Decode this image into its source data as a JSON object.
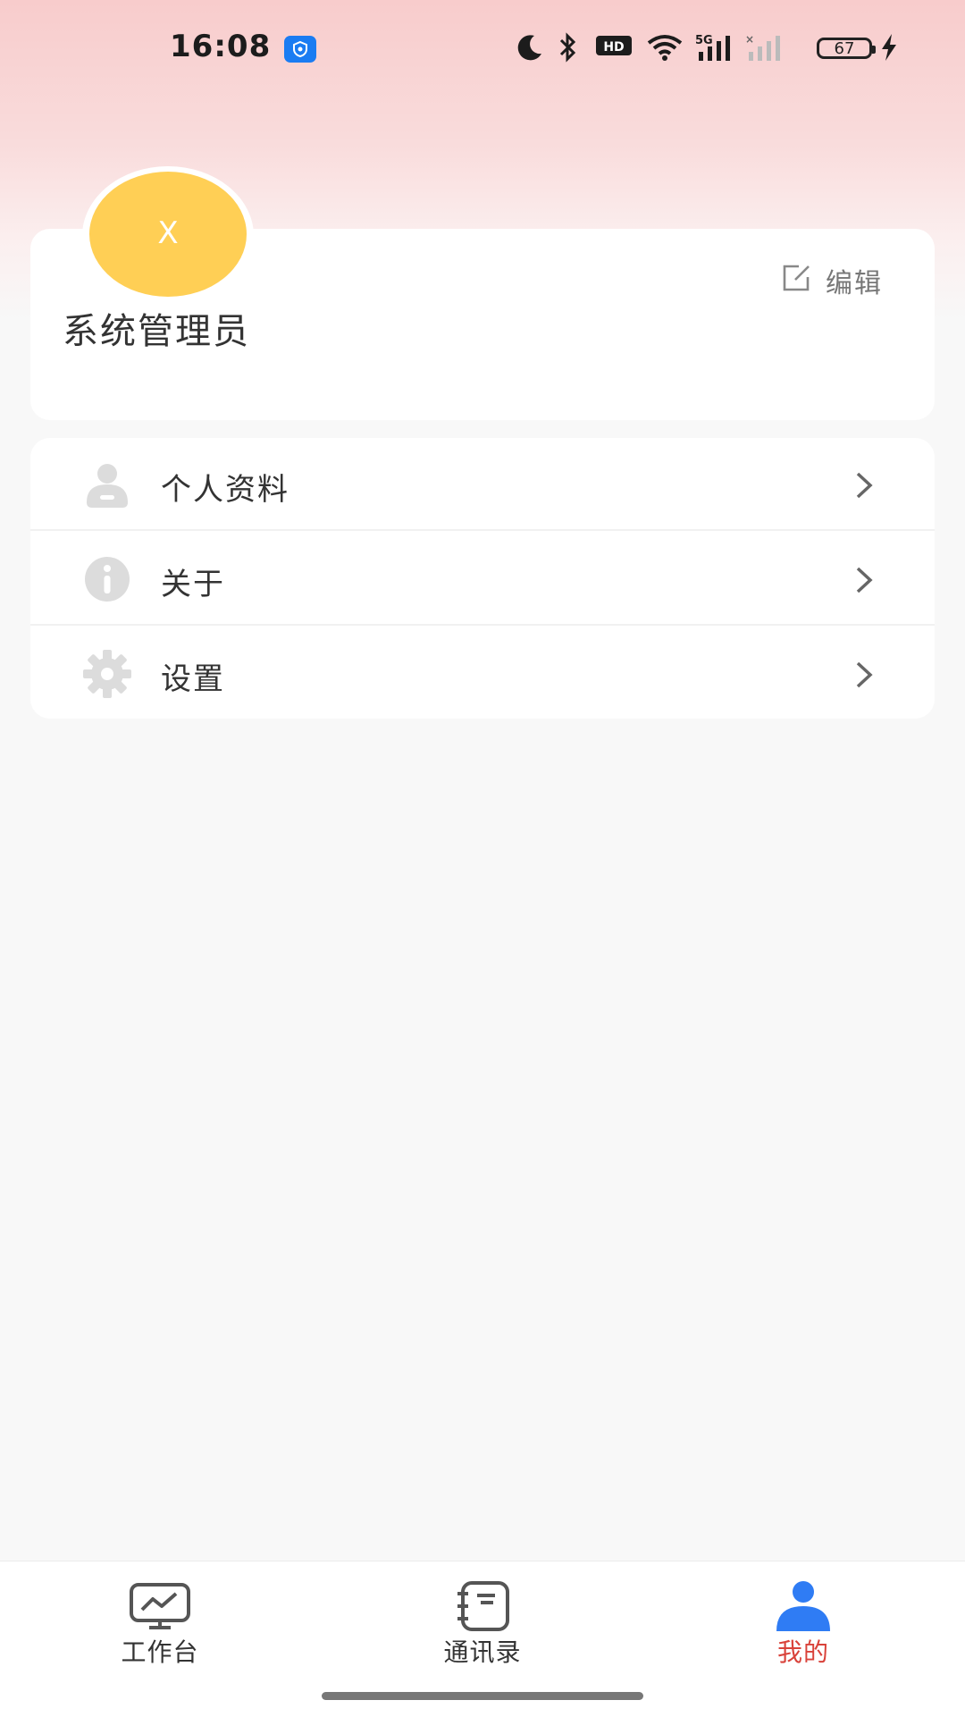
{
  "status_bar": {
    "time": "16:08",
    "battery": "67",
    "icons": [
      "vpn-shield-icon",
      "moon-icon",
      "bluetooth-icon",
      "hd-icon",
      "wifi-icon",
      "signal-5g-icon",
      "signal-icon",
      "battery-icon",
      "charging-icon"
    ]
  },
  "profile": {
    "avatar_text": "X",
    "name": "系统管理员",
    "edit_label": "编辑",
    "avatar_color": "#ffcf55"
  },
  "menu": {
    "items": [
      {
        "label": "个人资料",
        "icon": "user-icon"
      },
      {
        "label": "关于",
        "icon": "info-icon"
      },
      {
        "label": "设置",
        "icon": "gear-icon"
      }
    ]
  },
  "tabs": [
    {
      "label": "工作台",
      "icon": "dashboard-icon",
      "active": false
    },
    {
      "label": "通讯录",
      "icon": "contacts-icon",
      "active": false
    },
    {
      "label": "我的",
      "icon": "person-icon",
      "active": true
    }
  ],
  "colors": {
    "accent": "#d9423a",
    "active_icon": "#2f7cf4",
    "icon_gray": "#dcdcdc"
  }
}
